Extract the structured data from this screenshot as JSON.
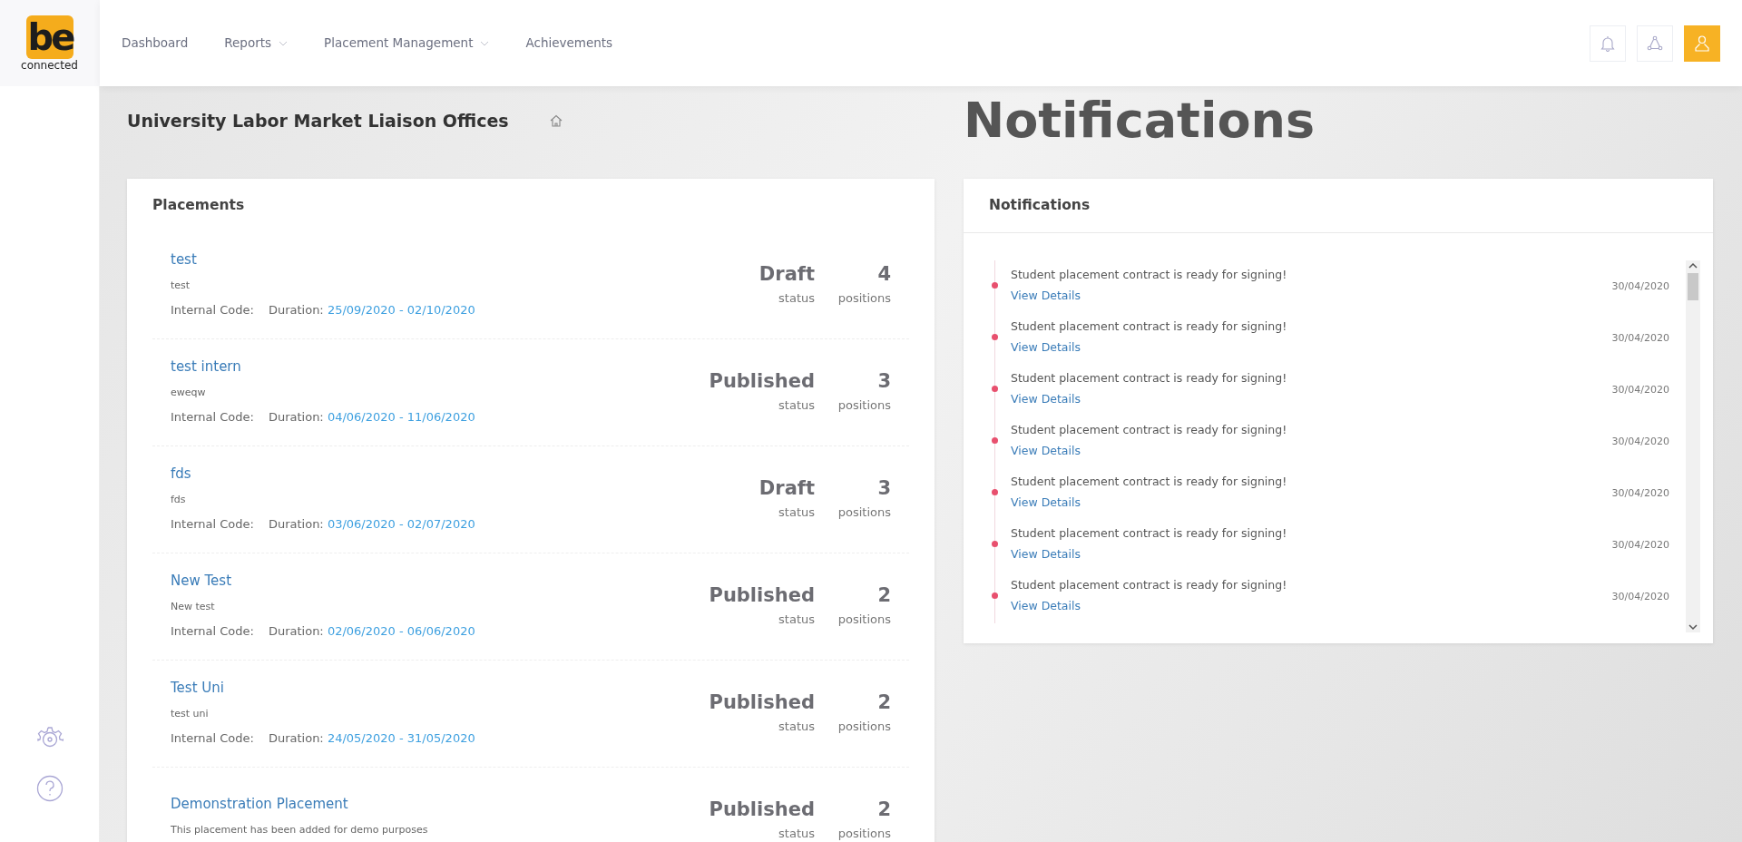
{
  "logo": {
    "mark": "be",
    "caption": "connected"
  },
  "nav": [
    {
      "label": "Dashboard",
      "dropdown": false
    },
    {
      "label": "Reports",
      "dropdown": true
    },
    {
      "label": "Placement Management",
      "dropdown": true
    },
    {
      "label": "Achievements",
      "dropdown": false
    }
  ],
  "page_title": "University Labor Market Liaison Offices",
  "overlay_heading": "Notifications",
  "placements": {
    "title": "Placements",
    "items": [
      {
        "name": "test",
        "description": "test",
        "internal_code_label": "Internal Code:",
        "duration_label": "Duration:",
        "duration": "25/09/2020 - 02/10/2020",
        "status": "Draft",
        "status_label": "status",
        "positions": "4",
        "positions_label": "positions"
      },
      {
        "name": "test intern",
        "description": "eweqw",
        "internal_code_label": "Internal Code:",
        "duration_label": "Duration:",
        "duration": "04/06/2020 - 11/06/2020",
        "status": "Published",
        "status_label": "status",
        "positions": "3",
        "positions_label": "positions"
      },
      {
        "name": "fds",
        "description": "fds",
        "internal_code_label": "Internal Code:",
        "duration_label": "Duration:",
        "duration": "03/06/2020 - 02/07/2020",
        "status": "Draft",
        "status_label": "status",
        "positions": "3",
        "positions_label": "positions"
      },
      {
        "name": "New Test",
        "description": "New test",
        "internal_code_label": "Internal Code:",
        "duration_label": "Duration:",
        "duration": "02/06/2020 - 06/06/2020",
        "status": "Published",
        "status_label": "status",
        "positions": "2",
        "positions_label": "positions"
      },
      {
        "name": "Test Uni",
        "description": "test uni",
        "internal_code_label": "Internal Code:",
        "duration_label": "Duration:",
        "duration": "24/05/2020 - 31/05/2020",
        "status": "Published",
        "status_label": "status",
        "positions": "2",
        "positions_label": "positions"
      },
      {
        "name": "Demonstration Placement",
        "description": "This placement has been added for demo purposes",
        "status": "Published",
        "status_label": "status",
        "positions": "2",
        "positions_label": "positions"
      }
    ]
  },
  "notifications": {
    "title": "Notifications",
    "items": [
      {
        "message": "Student placement contract is ready for signing!",
        "link": "View Details",
        "date": "30/04/2020",
        "color": "#e8506e"
      },
      {
        "message": "Student placement contract is ready for signing!",
        "link": "View Details",
        "date": "30/04/2020",
        "color": "#e8506e"
      },
      {
        "message": "Student placement contract is ready for signing!",
        "link": "View Details",
        "date": "30/04/2020",
        "color": "#e8506e"
      },
      {
        "message": "Student placement contract is ready for signing!",
        "link": "View Details",
        "date": "30/04/2020",
        "color": "#e8506e"
      },
      {
        "message": "Student placement contract is ready for signing!",
        "link": "View Details",
        "date": "30/04/2020",
        "color": "#e8506e"
      },
      {
        "message": "Student placement contract is ready for signing!",
        "link": "View Details",
        "date": "30/04/2020",
        "color": "#e8506e"
      },
      {
        "message": "Student placement contract is ready for signing!",
        "link": "View Details",
        "date": "30/04/2020",
        "color": "#e8506e"
      }
    ]
  }
}
